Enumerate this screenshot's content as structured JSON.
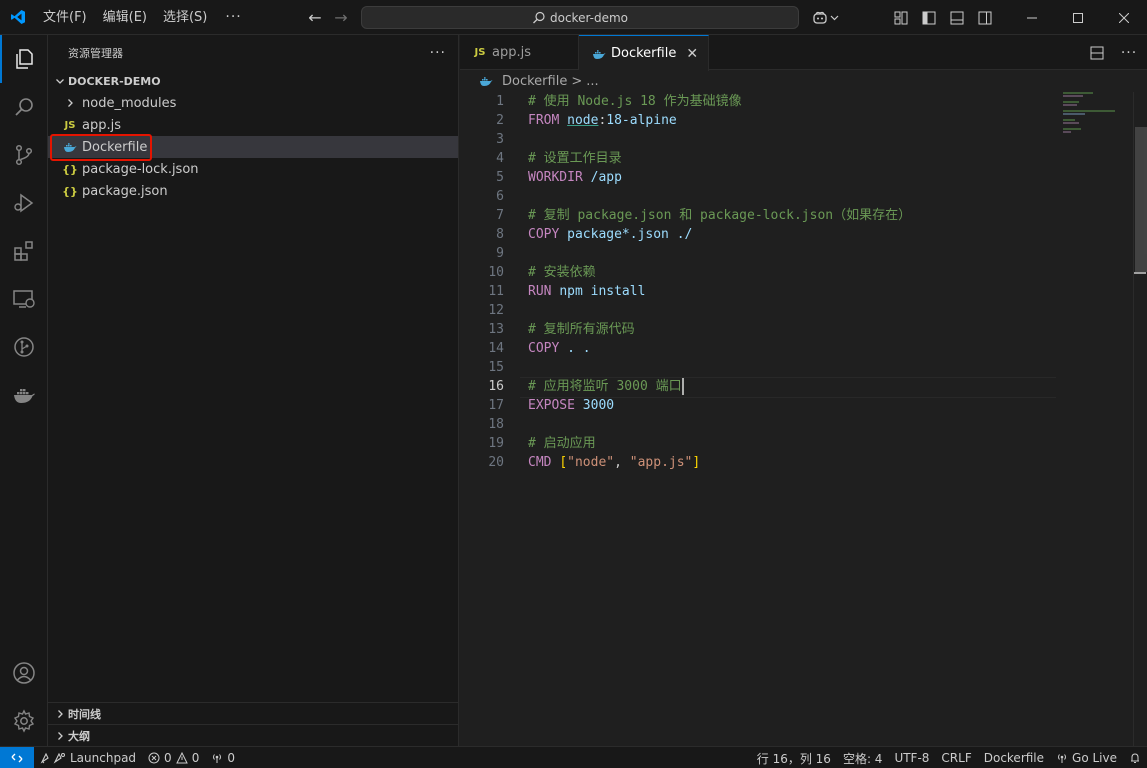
{
  "titlebar": {
    "menus": [
      "文件(F)",
      "编辑(E)",
      "选择(S)"
    ],
    "more": "···",
    "search_text": "docker-demo",
    "icons": [
      "vscode-logo",
      "back-arrow",
      "forward-arrow",
      "copilot-icon",
      "layout-icons",
      "minimize",
      "maximize",
      "close"
    ]
  },
  "sidebar": {
    "title": "资源管理器",
    "more": "···",
    "project": "DOCKER-DEMO",
    "items": [
      {
        "label": "node_modules",
        "type": "folder"
      },
      {
        "label": "app.js",
        "type": "js"
      },
      {
        "label": "Dockerfile",
        "type": "docker",
        "selected": true
      },
      {
        "label": "package-lock.json",
        "type": "json"
      },
      {
        "label": "package.json",
        "type": "json"
      }
    ],
    "timeline": "时间线",
    "outline": "大纲"
  },
  "editor": {
    "tabs": [
      {
        "label": "app.js",
        "icon": "js"
      },
      {
        "label": "Dockerfile",
        "icon": "docker",
        "active": true
      }
    ],
    "breadcrumb": {
      "file": "Dockerfile",
      "sep": ">",
      "rest": "..."
    },
    "current_line": 16
  },
  "statusbar": {
    "launchpad": "Launchpad",
    "errors": "0",
    "warnings": "0",
    "ports": "0",
    "position": "行 16，列 16",
    "spaces": "空格: 4",
    "encoding": "UTF-8",
    "eol": "CRLF",
    "language": "Dockerfile",
    "golive": "Go Live"
  },
  "colors": {
    "accent": "#0078d4",
    "highlight": "#e51400",
    "comment": "#6a9955",
    "keyword": "#c586c0"
  }
}
